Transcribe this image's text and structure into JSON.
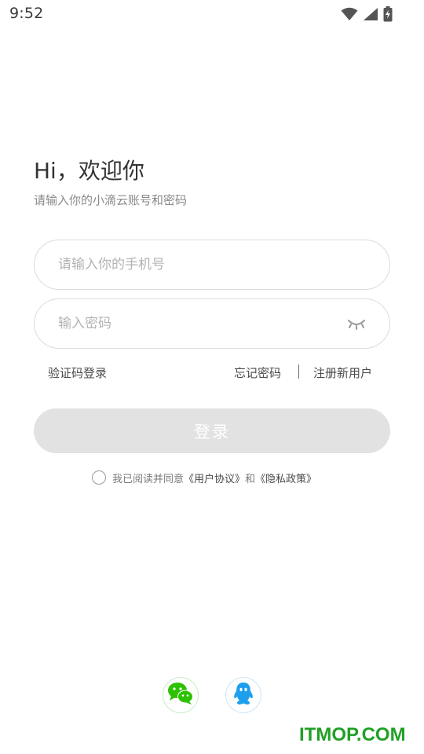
{
  "status_bar": {
    "time": "9:52",
    "icons": [
      "wifi-icon",
      "cell-signal-icon",
      "battery-charging-icon"
    ]
  },
  "login": {
    "greeting": "Hi，欢迎你",
    "subtitle": "请输入你的小滴云账号和密码",
    "phone_placeholder": "请输入你的手机号",
    "phone_value": "",
    "password_placeholder": "输入密码",
    "password_value": "",
    "sms_login_label": "验证码登录",
    "forgot_password_label": "忘记密码",
    "register_label": "注册新用户",
    "login_button_label": "登录"
  },
  "agreement": {
    "prefix": "我已阅读并同意",
    "user_agreement": "《用户协议》",
    "conjunction": "和",
    "privacy_policy": "《隐私政策》"
  },
  "social_login": {
    "icons": [
      "wechat-icon",
      "qq-icon"
    ]
  },
  "watermark": "ITMOP.COM",
  "colors": {
    "wechat_green": "#2dc100",
    "qq_blue": "#1e9fee",
    "button_disabled": "#e2e2e2",
    "watermark_green": "#21a025"
  }
}
